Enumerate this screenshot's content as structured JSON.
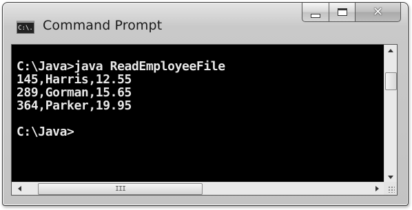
{
  "window": {
    "title": "Command Prompt",
    "app_icon_text": "C:\\."
  },
  "console": {
    "lines": [
      "",
      "C:\\Java>java ReadEmployeeFile",
      "145,Harris,12.55",
      "289,Gorman,15.65",
      "364,Parker,19.95",
      "",
      "C:\\Java>"
    ]
  },
  "scrollbar": {
    "horizontal_thumb_grip": "III"
  },
  "colors": {
    "console_background": "#000000",
    "console_text": "#e8e8e8",
    "frame": "#c6c6c6"
  }
}
